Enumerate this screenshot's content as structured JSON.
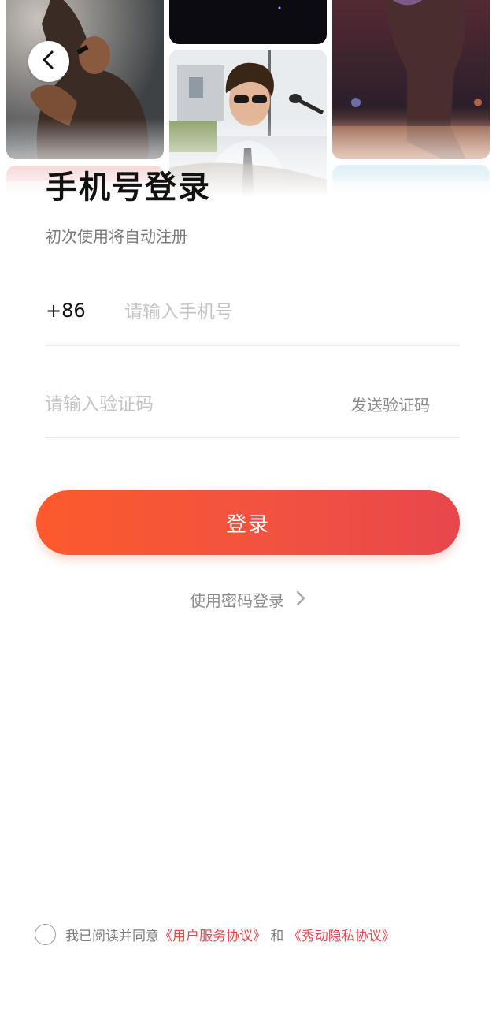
{
  "header": {
    "back_icon": "chevron-left-icon",
    "photos": [
      "singer-microphone",
      "dark-stage",
      "drummer-sunglasses",
      "performer-crowd",
      "stage-lights",
      "sky-stage"
    ]
  },
  "login": {
    "title": "手机号登录",
    "subtitle": "初次使用将自动注册",
    "country_code": "+86",
    "phone_placeholder": "请输入手机号",
    "code_placeholder": "请输入验证码",
    "send_code_label": "发送验证码",
    "submit_label": "登录",
    "password_login_label": "使用密码登录"
  },
  "agreement": {
    "prefix": "我已阅读并同意",
    "user_agreement": "《用户服务协议》",
    "conjunction": "和",
    "privacy_agreement": "《秀动隐私协议》"
  },
  "colors": {
    "accent_start": "#fc5a2c",
    "accent_end": "#e8474c",
    "link": "#e7474c"
  }
}
